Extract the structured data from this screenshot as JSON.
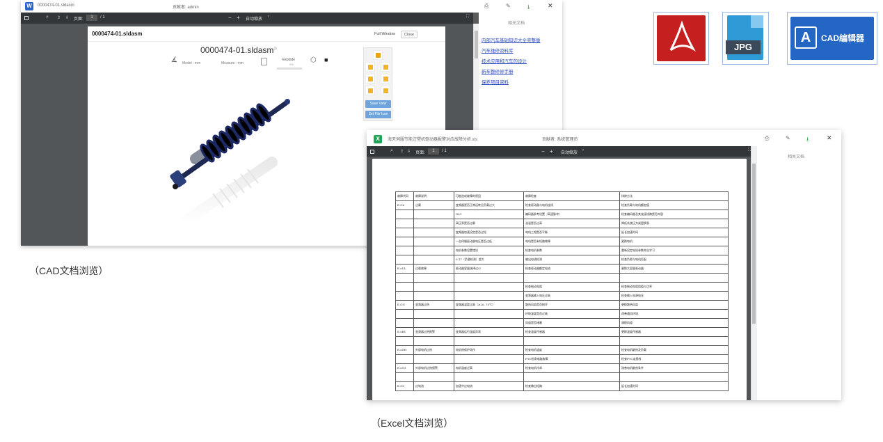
{
  "cad": {
    "tab_title": "0000474-01.sldasm",
    "contributor": "贡献者: admin",
    "toolbar": {
      "page_label": "页面:",
      "page_value": "1",
      "page_total": "/ 1",
      "zoom": "自动缩放",
      "minus": "−",
      "plus": "+"
    },
    "doc_title": "0000474-01.sldasm",
    "full_window": "Full Window",
    "close": "Close",
    "model_title": "0000474-01.sldasm",
    "model_unit": "Model : mm",
    "measure_unit": "Measure : mm",
    "explode": "Explode",
    "explode_value": "0%",
    "save_view": "Save View",
    "set_file_icon": "Set File Icon",
    "side_title": "相关文档",
    "related": [
      "内部汽车基础知识大全完整版",
      "汽车维修资料库",
      "技术应用和汽车的设计",
      "新车整修修手册",
      "保养项目资料"
    ]
  },
  "xls": {
    "tab_title": "海天伺服节能注塑机驱动器报警对应故障分析.xls",
    "contributor": "贡献者: 系统管理员",
    "toolbar": {
      "page_label": "页面:",
      "page_value": "1",
      "page_total": "/ 1",
      "zoom": "自动缩放",
      "minus": "−",
      "plus": "+"
    },
    "side_title": "相关文档",
    "headers": [
      "故障代码",
      "故障说明",
      "可能造成故障的原因",
      "故障检查",
      "排除方法"
    ],
    "rows": [
      [
        "E.OL",
        "过载",
        "变频器是否正常运转且负载过大",
        "检查驱动器与电机连线",
        "检查负载与电机额定值"
      ],
      [
        "",
        "",
        "OL1",
        "编码器参考设置（高速脉冲）",
        "检查编码器及其连接线路是否牢固"
      ],
      [
        "",
        "",
        "高压泵是否过载",
        "油温是否过高",
        "降低系统压力或更换泵"
      ],
      [
        "",
        "",
        "变频器加速设定是否过短",
        "电机三相是否平衡",
        "延长加速时间"
      ],
      [
        "",
        "",
        "一台伺服驱动器电压是否过低",
        "电机是否有短路故障",
        "更换电机"
      ],
      [
        "",
        "",
        "电机参数设置错误",
        "检查电机参数",
        "重新设定电机参数并自学习"
      ],
      [
        "",
        "",
        "0.17（负载检测）超大",
        "输出电流检测",
        "检查负载与电机匹配"
      ],
      [
        "E.oUL",
        "过载故障",
        "驱动器容量选择过小",
        "检查驱动器额定电流",
        "更换大容量驱动器"
      ],
      [
        "",
        "",
        "",
        "",
        ""
      ],
      [
        "",
        "",
        "",
        "检查制动电阻",
        "检查制动电阻阻值与功率"
      ],
      [
        "",
        "",
        "",
        "变频器输入电压过高",
        "检查输入电源电压"
      ],
      [
        "E.OU",
        "变频器过热",
        "变频器温度过高（≥20, 75℃）",
        "散热风扇是否损坏",
        "更换散热风扇"
      ],
      [
        "",
        "",
        "",
        "环境温度是否过高",
        "改善通风环境"
      ],
      [
        "",
        "",
        "",
        "风道是否堵塞",
        "清理风道"
      ],
      [
        "E.oHI",
        "变频器过热报警",
        "变频器运行温度异常",
        "检查温度传感器",
        "更换温度传感器"
      ],
      [
        "",
        "",
        "",
        "",
        ""
      ],
      [
        "E.oOH",
        "外部电机过热",
        "电机热保护动作",
        "检查电机温度",
        "检查电机散热及负载"
      ],
      [
        "",
        "",
        "",
        "PTC检测电路故障",
        "检查PTC连接线"
      ],
      [
        "E.oO3",
        "外部电机过热报警",
        "电机温度过高",
        "检查电机冷却",
        "改善电机散热条件"
      ],
      [
        "",
        "",
        "",
        "",
        ""
      ],
      [
        "E.OC",
        "过电流",
        "加速中过电流",
        "检查输出短路",
        "延长加速时间"
      ]
    ]
  },
  "captions": {
    "cad": "（CAD文档浏览）",
    "excel": "（Excel文档浏览）"
  },
  "file_icons": {
    "pdf_label": "PDF",
    "jpg_label": "JPG",
    "cad_label": "CAD编辑器"
  }
}
